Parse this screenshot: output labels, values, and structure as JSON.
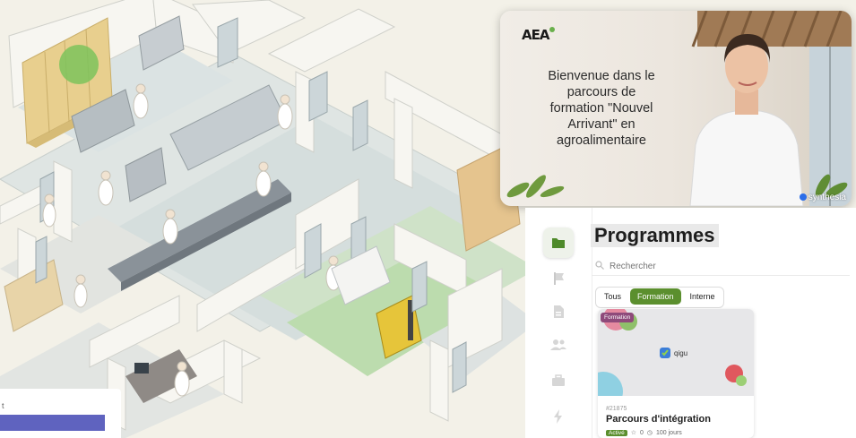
{
  "left_panel": {
    "fragment_text": "t"
  },
  "video": {
    "logo": "AEA",
    "welcome_lines": [
      "Bienvenue dans le",
      "parcours de",
      "formation \"Nouvel",
      "Arrivant\" en",
      "agroalimentaire"
    ],
    "watermark": "synthesia"
  },
  "app": {
    "sidebar": {
      "items": [
        {
          "icon": "folder-icon",
          "active": true
        },
        {
          "icon": "flag-icon",
          "active": false
        },
        {
          "icon": "document-icon",
          "active": false
        },
        {
          "icon": "users-icon",
          "active": false
        },
        {
          "icon": "briefcase-icon",
          "active": false
        },
        {
          "icon": "lightning-icon",
          "active": false
        }
      ]
    },
    "title": "Programmes",
    "search": {
      "placeholder": "Rechercher"
    },
    "tabs": [
      {
        "label": "Tous",
        "active": false
      },
      {
        "label": "Formation",
        "active": true
      },
      {
        "label": "Interne",
        "active": false
      }
    ],
    "card": {
      "badge": "Formation",
      "brand": "qigu",
      "code": "#21875",
      "title": "Parcours d'intégration",
      "status": "Activé",
      "rating": "0",
      "duration": "100 jours"
    }
  },
  "colors": {
    "accent": "#5b8f2e",
    "badge": "#8e4a7a",
    "left_bar": "#5f63bf"
  }
}
